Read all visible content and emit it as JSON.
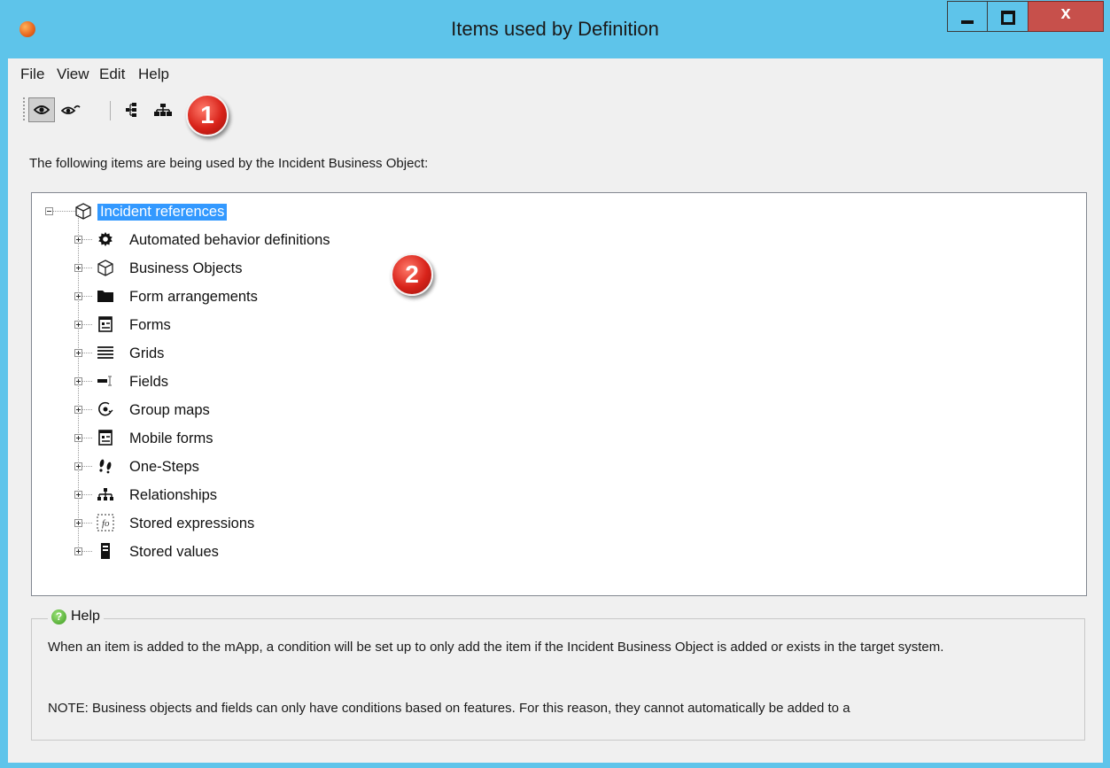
{
  "window": {
    "title": "Items used by Definition",
    "close_glyph": "x"
  },
  "menu": [
    "File",
    "View",
    "Edit",
    "Help"
  ],
  "toolbar": {
    "buttons": [
      {
        "icon": "eye-icon",
        "active": true
      },
      {
        "icon": "eye-link-icon",
        "active": false
      },
      {
        "icon": "tree-expand-icon",
        "active": false
      },
      {
        "icon": "hierarchy-icon",
        "active": false
      }
    ]
  },
  "callouts": {
    "one": "1",
    "two": "2"
  },
  "description": "The following items are being used by the Incident Business Object:",
  "tree": {
    "root": {
      "label": "Incident references",
      "icon": "cube-icon",
      "expanded": true
    },
    "children": [
      {
        "label": "Automated behavior definitions",
        "icon": "gear-icon"
      },
      {
        "label": "Business Objects",
        "icon": "cube-icon"
      },
      {
        "label": "Form arrangements",
        "icon": "folder-icon"
      },
      {
        "label": "Forms",
        "icon": "form-icon"
      },
      {
        "label": "Grids",
        "icon": "grid-lines-icon"
      },
      {
        "label": "Fields",
        "icon": "field-icon"
      },
      {
        "label": "Group maps",
        "icon": "group-map-icon"
      },
      {
        "label": "Mobile forms",
        "icon": "form-icon"
      },
      {
        "label": "One-Steps",
        "icon": "footsteps-icon"
      },
      {
        "label": "Relationships",
        "icon": "relationship-icon"
      },
      {
        "label": "Stored expressions",
        "icon": "expression-icon"
      },
      {
        "label": "Stored values",
        "icon": "stored-value-icon"
      }
    ]
  },
  "help": {
    "legend": "Help",
    "icon": "help-icon",
    "text": "When an item is added to the mApp, a condition will be set up to only add the item if the Incident Business Object is added or exists in the target system.",
    "note": "NOTE: Business objects and fields can only have conditions based on features. For this reason, they cannot automatically be added to a"
  },
  "colors": {
    "titlebar": "#5ec4ea",
    "selection": "#3399ff",
    "close_button": "#c7504b",
    "callout": "#d8231a"
  }
}
